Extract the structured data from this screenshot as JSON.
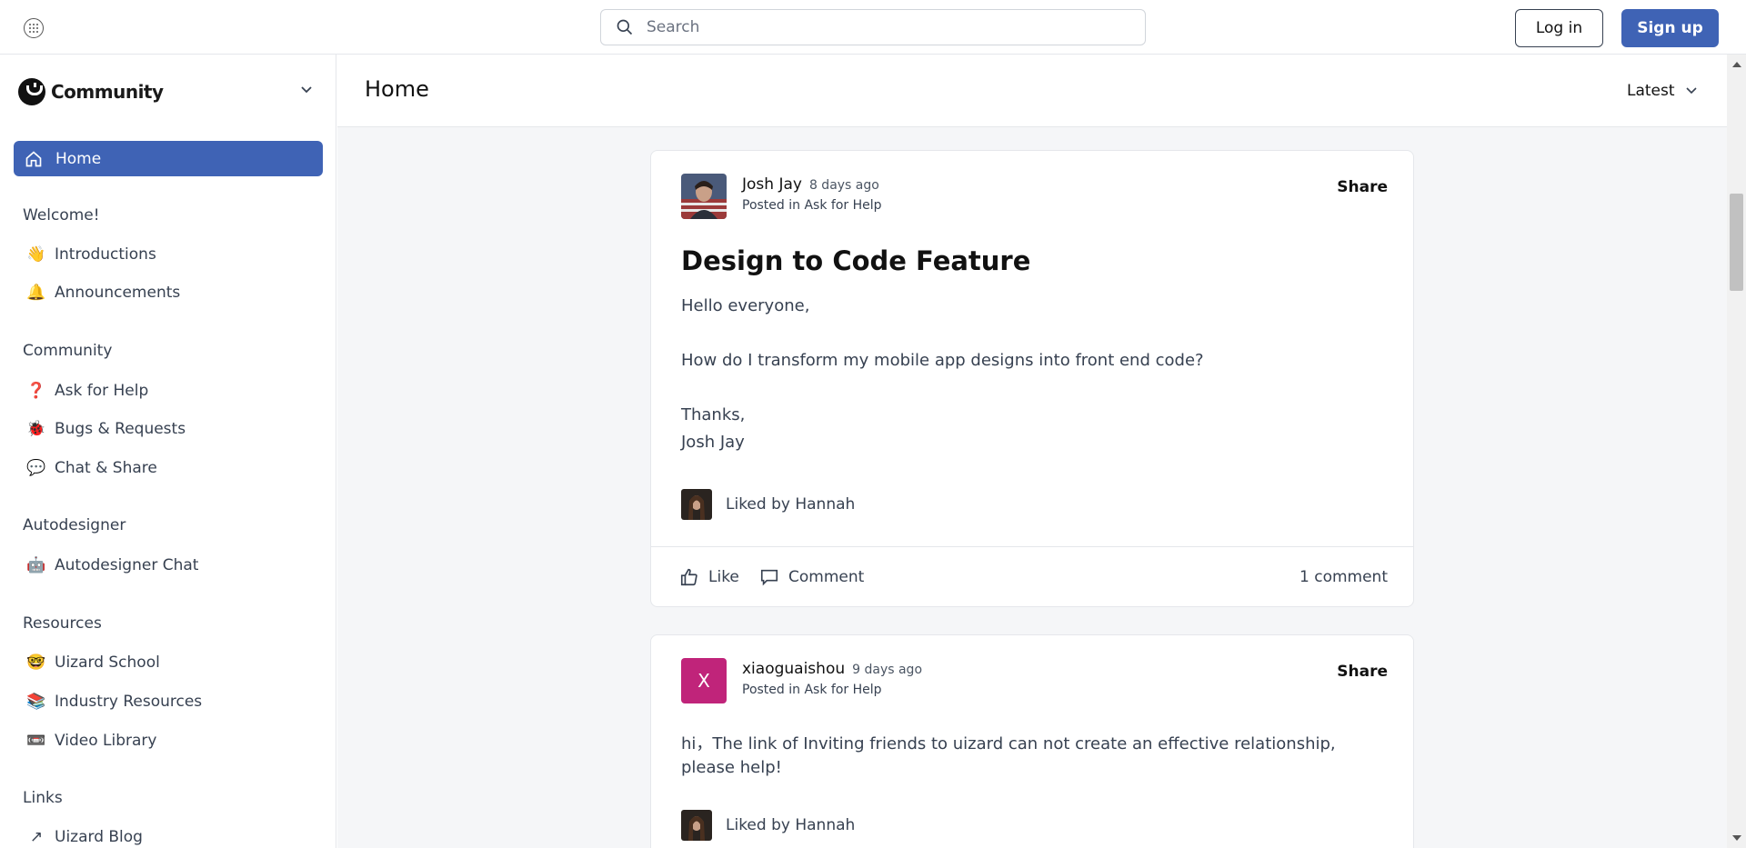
{
  "topbar": {
    "search_placeholder": "Search",
    "login_label": "Log in",
    "signup_label": "Sign up"
  },
  "sidebar": {
    "brand_name": "Community",
    "home_label": "Home",
    "sections": [
      {
        "title": "Welcome!",
        "items": [
          {
            "emoji": "👋",
            "label": "Introductions"
          },
          {
            "emoji": "🔔",
            "label": "Announcements"
          }
        ]
      },
      {
        "title": "Community",
        "items": [
          {
            "emoji": "❓",
            "label": "Ask for Help"
          },
          {
            "emoji": "🐞",
            "label": "Bugs & Requests"
          },
          {
            "emoji": "💬",
            "label": "Chat & Share"
          }
        ]
      },
      {
        "title": "Autodesigner",
        "items": [
          {
            "emoji": "🤖",
            "label": "Autodesigner Chat"
          }
        ]
      },
      {
        "title": "Resources",
        "items": [
          {
            "emoji": "🤓",
            "label": "Uizard School"
          },
          {
            "emoji": "📚",
            "label": "Industry Resources"
          },
          {
            "emoji": "📼",
            "label": "Video Library"
          }
        ]
      },
      {
        "title": "Links",
        "items": [
          {
            "emoji": "↗",
            "label": "Uizard Blog"
          }
        ]
      }
    ]
  },
  "main": {
    "title": "Home",
    "sort_label": "Latest"
  },
  "posts": [
    {
      "author": "Josh Jay",
      "time": "8 days ago",
      "posted_in": "Posted in Ask for Help",
      "share_label": "Share",
      "title": "Design to Code Feature",
      "body": [
        "Hello everyone,",
        "How do I transform my mobile app designs into front end code?",
        "Thanks,",
        "Josh Jay"
      ],
      "liked_by": "Liked by Hannah",
      "like_label": "Like",
      "comment_label": "Comment",
      "comment_count": "1 comment"
    },
    {
      "author": "xiaoguaishou",
      "avatar_letter": "X",
      "time": "9 days ago",
      "posted_in": "Posted in Ask for Help",
      "share_label": "Share",
      "body": [
        "hi，The link of Inviting friends to uizard  can not create an effective relationship,",
        "please help!"
      ],
      "liked_by": "Liked by Hannah"
    }
  ]
}
